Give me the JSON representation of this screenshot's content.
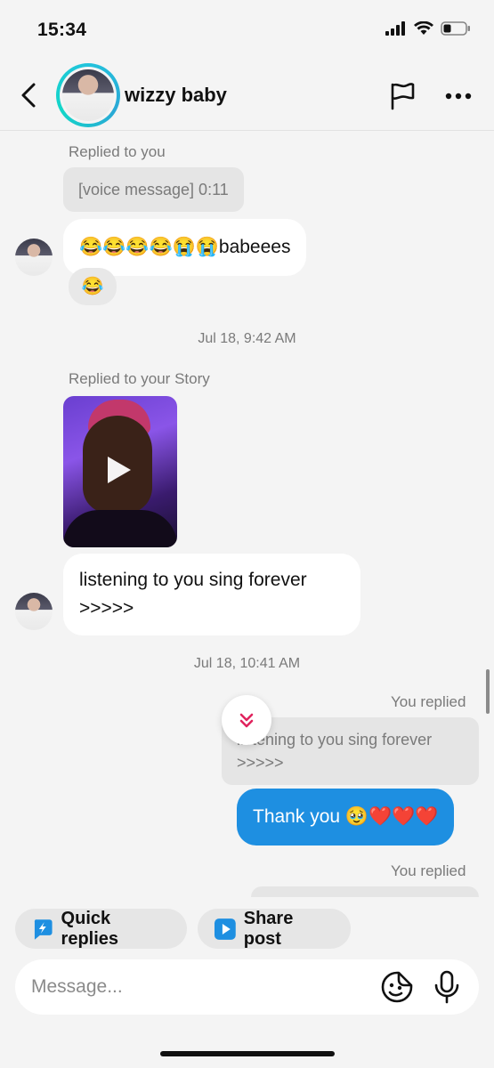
{
  "status_bar": {
    "time": "15:34"
  },
  "header": {
    "name": "wizzy baby"
  },
  "messages": {
    "label_replied_to_you": "Replied to you",
    "voice_quote": "[voice message] 0:11",
    "msg1_text": "😂😂😂😂😭😭babeees",
    "msg1_reaction": "😂",
    "timestamp1": "Jul 18, 9:42 AM",
    "label_replied_story": "Replied to your Story",
    "msg2_line1": "listening to you sing forever",
    "msg2_line2": ">>>>>",
    "timestamp2": "Jul 18, 10:41 AM",
    "label_you_replied": "You replied",
    "out_quote_line1": "listening to you sing forever",
    "out_quote_line2": ">>>>>",
    "out_text": "Thank you 🥹❤️❤️❤️",
    "label_you_replied_2": "You replied"
  },
  "chips": {
    "quick_replies": "Quick replies",
    "share_post": "Share post"
  },
  "composer": {
    "placeholder": "Message..."
  },
  "colors": {
    "accent_blue": "#1e8fe1",
    "ring": "#22c3dc",
    "scroll_chevron": "#e0245e"
  }
}
